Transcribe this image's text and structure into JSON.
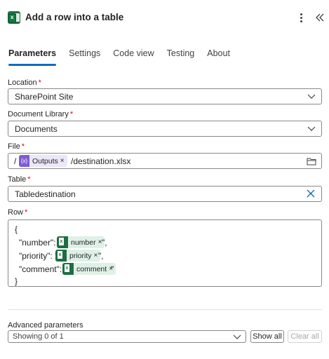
{
  "header": {
    "title": "Add a row into a table",
    "app_icon": "excel-icon",
    "brand_color": "#1d6f42"
  },
  "tabs": [
    {
      "label": "Parameters",
      "active": true
    },
    {
      "label": "Settings",
      "active": false
    },
    {
      "label": "Code view",
      "active": false
    },
    {
      "label": "Testing",
      "active": false
    },
    {
      "label": "About",
      "active": false
    }
  ],
  "fields": {
    "location": {
      "label": "Location",
      "required": "*",
      "value": "SharePoint Site"
    },
    "document_library": {
      "label": "Document Library",
      "required": "*",
      "value": "Documents"
    },
    "file": {
      "label": "File",
      "required": "*",
      "prefix": "/",
      "token": "Outputs",
      "token_remove": "×",
      "suffix": "/destination.xlsx"
    },
    "table": {
      "label": "Table",
      "required": "*",
      "value": "Tabledestination"
    },
    "row": {
      "label": "Row",
      "required": "*",
      "open_brace": "{",
      "close_brace": "}",
      "lines": [
        {
          "key": "\"number\": \"",
          "token": "number",
          "token_remove": "×",
          "end": "\","
        },
        {
          "key": "\"priority\": \"",
          "token": "priority",
          "token_remove": "×",
          "end": "\","
        },
        {
          "key": "\"comment\": \"",
          "token": "comment",
          "token_remove": "×",
          "end": "\""
        }
      ]
    }
  },
  "advanced": {
    "label": "Advanced parameters",
    "select_value": "Showing 0 of 1",
    "show_all": "Show all",
    "clear_all": "Clear all"
  },
  "colors": {
    "accent": "#0f6cbd",
    "required": "#c50f1f",
    "expression_token": "#7b5cd6",
    "excel_token": "#1d6f42"
  }
}
